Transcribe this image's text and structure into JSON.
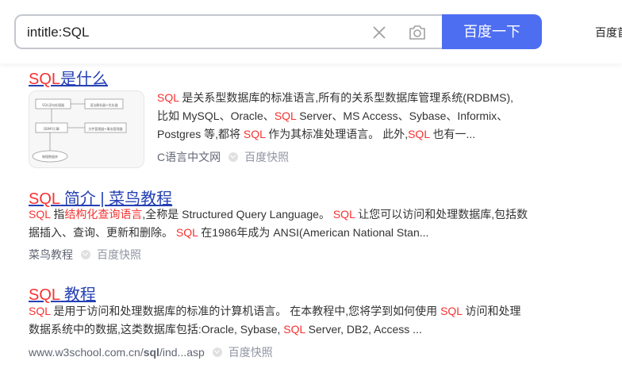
{
  "search": {
    "query": "intitle:SQL",
    "button_label": "百度一下",
    "top_right_link": "百度首"
  },
  "results": [
    {
      "title_parts": [
        "SQL",
        "是什么"
      ],
      "snippet": [
        {
          "t": "SQL",
          "h": true
        },
        {
          "t": " 是关系型数据库的标准语言,所有的关系型数据库管理系统(RDBMS),比如 MySQL、Oracle、",
          "h": false
        },
        {
          "t": "SQL",
          "h": true
        },
        {
          "t": " Server、MS Access、Sybase、Informix、Postgres 等,都将 ",
          "h": false
        },
        {
          "t": "SQL",
          "h": true
        },
        {
          "t": " 作为其标准处理语言。 此外,",
          "h": false
        },
        {
          "t": "SQL",
          "h": true
        },
        {
          "t": " 也有一...",
          "h": false
        }
      ],
      "source_name": "C语言中文网",
      "kuaizhao": "百度快照",
      "thumb_labels": [
        "SQL语句处理器",
        "语法解析器+优化器",
        "DBMS引擎",
        "文件管理器+事务管理器",
        "物理数据库"
      ]
    },
    {
      "title_parts": [
        "SQL",
        " 简介 | 菜鸟教程"
      ],
      "snippet": [
        {
          "t": "SQL",
          "h": true
        },
        {
          "t": " 指",
          "h": false
        },
        {
          "t": "结构化查询语言",
          "h": true
        },
        {
          "t": ",全称是 Structured Query Language。 ",
          "h": false
        },
        {
          "t": "SQL",
          "h": true
        },
        {
          "t": " 让您可以访问和处理数据库,包括数据插入、查询、更新和删除。 ",
          "h": false
        },
        {
          "t": "SQL",
          "h": true
        },
        {
          "t": " 在1986年成为 ANSI(American National Stan...",
          "h": false
        }
      ],
      "source_name": "菜鸟教程",
      "kuaizhao": "百度快照"
    },
    {
      "title_parts": [
        "SQL",
        " 教程"
      ],
      "snippet": [
        {
          "t": "SQL",
          "h": true
        },
        {
          "t": " 是用于访问和处理数据库的标准的计算机语言。 在本教程中,您将学到如何使用 ",
          "h": false
        },
        {
          "t": "SQL",
          "h": true
        },
        {
          "t": " 访问和处理数据系统中的数据,这类数据库包括:Oracle, Sybase, ",
          "h": false
        },
        {
          "t": "SQL",
          "h": true
        },
        {
          "t": " Server, DB2, Access ...",
          "h": false
        }
      ],
      "source_url_prefix": "www.w3school.com.cn/",
      "source_url_bold": "sql",
      "source_url_suffix": "/ind...asp",
      "kuaizhao": "百度快照"
    }
  ],
  "colors": {
    "link": "#2440b3",
    "highlight": "#f73131",
    "button": "#4e6ef2"
  }
}
